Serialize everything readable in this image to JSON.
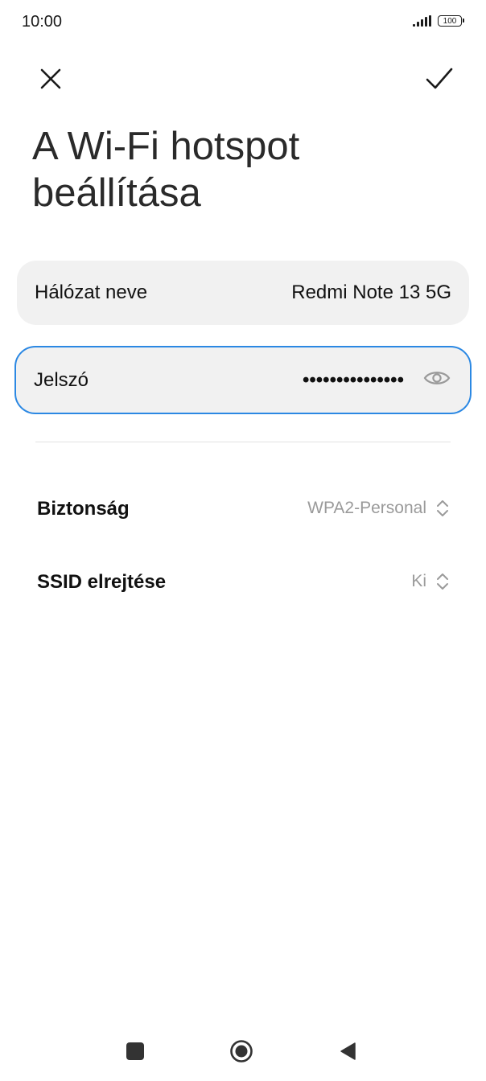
{
  "status_bar": {
    "time": "10:00",
    "battery": "100",
    "icons": [
      "signal-icon",
      "battery-icon"
    ]
  },
  "toolbar": {
    "close_icon": "close-icon",
    "confirm_icon": "check-icon"
  },
  "page": {
    "title": "A Wi-Fi hotspot beállítása"
  },
  "fields": {
    "network_name": {
      "label": "Hálózat neve",
      "value": "Redmi Note 13 5G"
    },
    "password": {
      "label": "Jelszó",
      "value": "•••••••••••••••",
      "icon": "eye-icon"
    }
  },
  "settings": {
    "security": {
      "label": "Biztonság",
      "value": "WPA2-Personal",
      "icon": "updown-chevron-icon"
    },
    "hide_ssid": {
      "label": "SSID elrejtése",
      "value": "Ki",
      "icon": "updown-chevron-icon"
    }
  },
  "colors": {
    "accent": "#2b88e3",
    "card_bg": "#f1f1f1",
    "secondary_text": "#9a9a9a"
  },
  "nav_bar": {
    "icons": [
      "recents-icon",
      "home-icon",
      "back-icon"
    ]
  }
}
